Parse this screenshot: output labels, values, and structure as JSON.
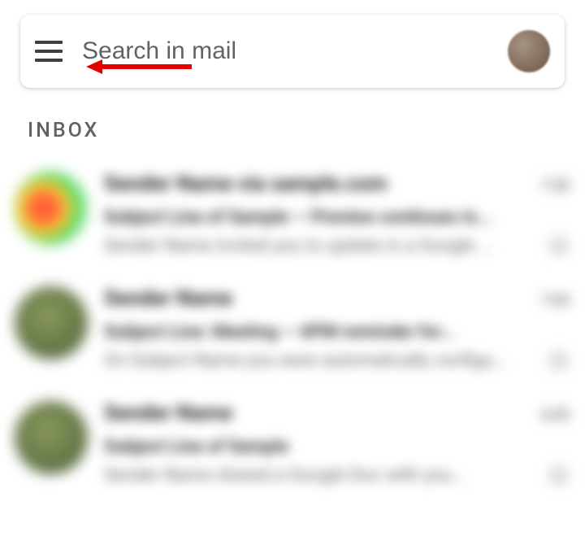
{
  "header": {
    "search_placeholder": "Search in mail"
  },
  "section": {
    "label": "INBOX"
  },
  "emails": [
    {
      "sender": "Sender Name via sample.com",
      "time": "7:30",
      "subject": "Subject Line of Sample — Preview continues in...",
      "preview": "Sender Name invited you to update in a Google ..."
    },
    {
      "sender": "Sender Name",
      "time": "7:04",
      "subject": "Subject Line: Meeting — 6PM reminder for...",
      "preview": "On Subject Name you were automatically configu..."
    },
    {
      "sender": "Sender Name",
      "time": "6:55",
      "subject": "Subject Line of Sample",
      "preview": "Sender Name shared a Google Doc with you..."
    }
  ]
}
